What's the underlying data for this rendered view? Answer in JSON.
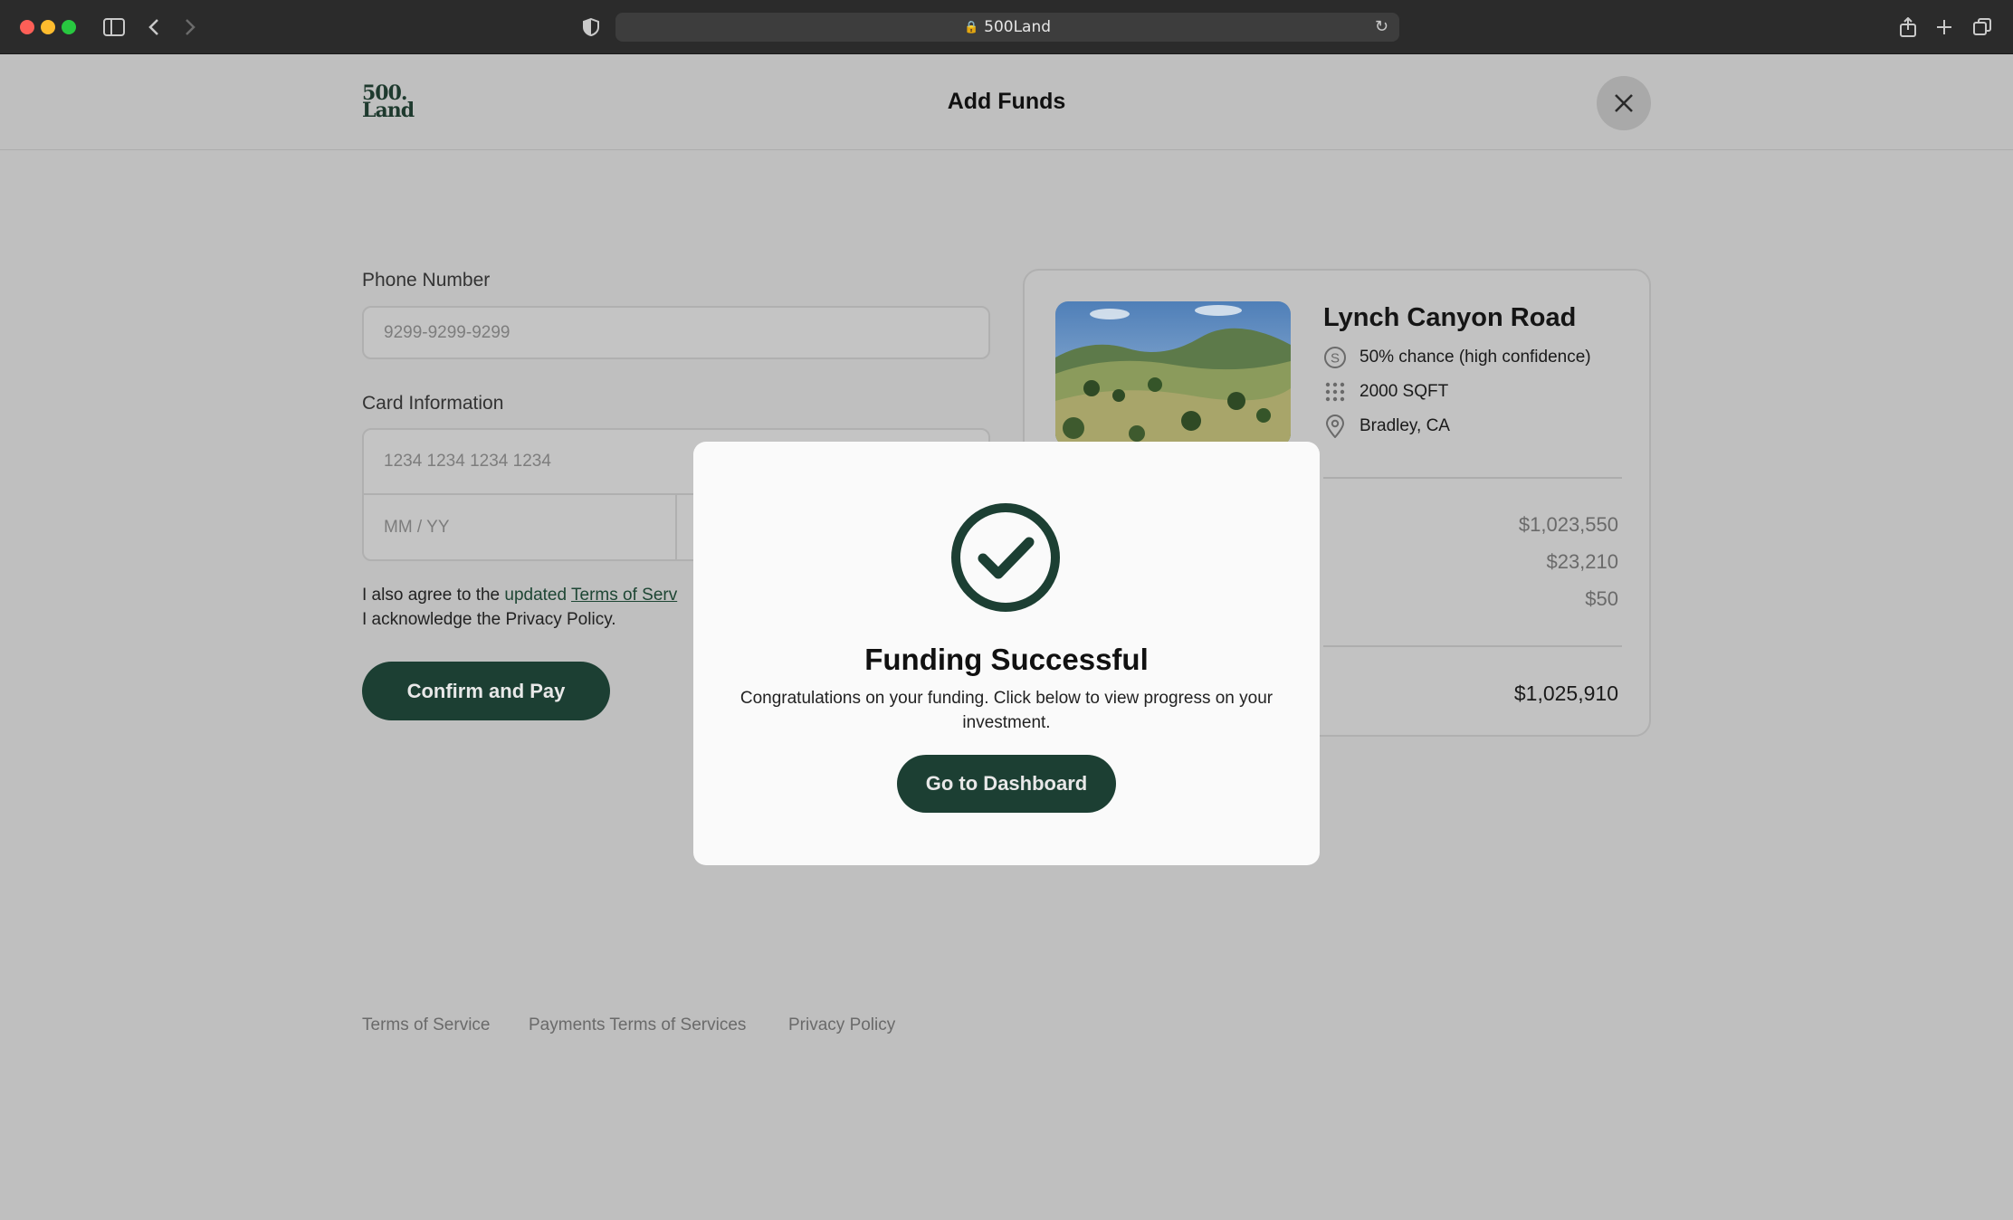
{
  "browser": {
    "url": "500Land"
  },
  "header": {
    "logo_line1": "500.",
    "logo_line2": "Land",
    "title": "Add Funds"
  },
  "form": {
    "phone_label": "Phone Number",
    "phone_placeholder": "9299-9299-9299",
    "card_label": "Card Information",
    "card_number_placeholder": "1234 1234 1234 1234",
    "expiry_placeholder": "MM / YY",
    "agree_prefix": "I also agree to the ",
    "agree_updated": "updated ",
    "agree_terms_link": "Terms of Serv",
    "agree_line2": "I acknowledge the Privacy Policy.",
    "confirm_label": "Confirm and Pay"
  },
  "property": {
    "name": "Lynch Canyon Road",
    "chance": "50% chance (high confidence)",
    "area": "2000 SQFT",
    "location": "Bradley, CA",
    "amounts": [
      "$1,023,550",
      "$23,210",
      "$50"
    ],
    "total": "$1,025,910"
  },
  "footer": {
    "links": [
      "Terms of Service",
      "Payments Terms of Services",
      "Privacy Policy"
    ]
  },
  "modal": {
    "title": "Funding Successful",
    "message": "Congratulations on your funding. Click below to view progress on your investment.",
    "button_label": "Go to Dashboard"
  },
  "colors": {
    "brand_green": "#1c3f33",
    "overlay_background": "#bfbfbf"
  }
}
